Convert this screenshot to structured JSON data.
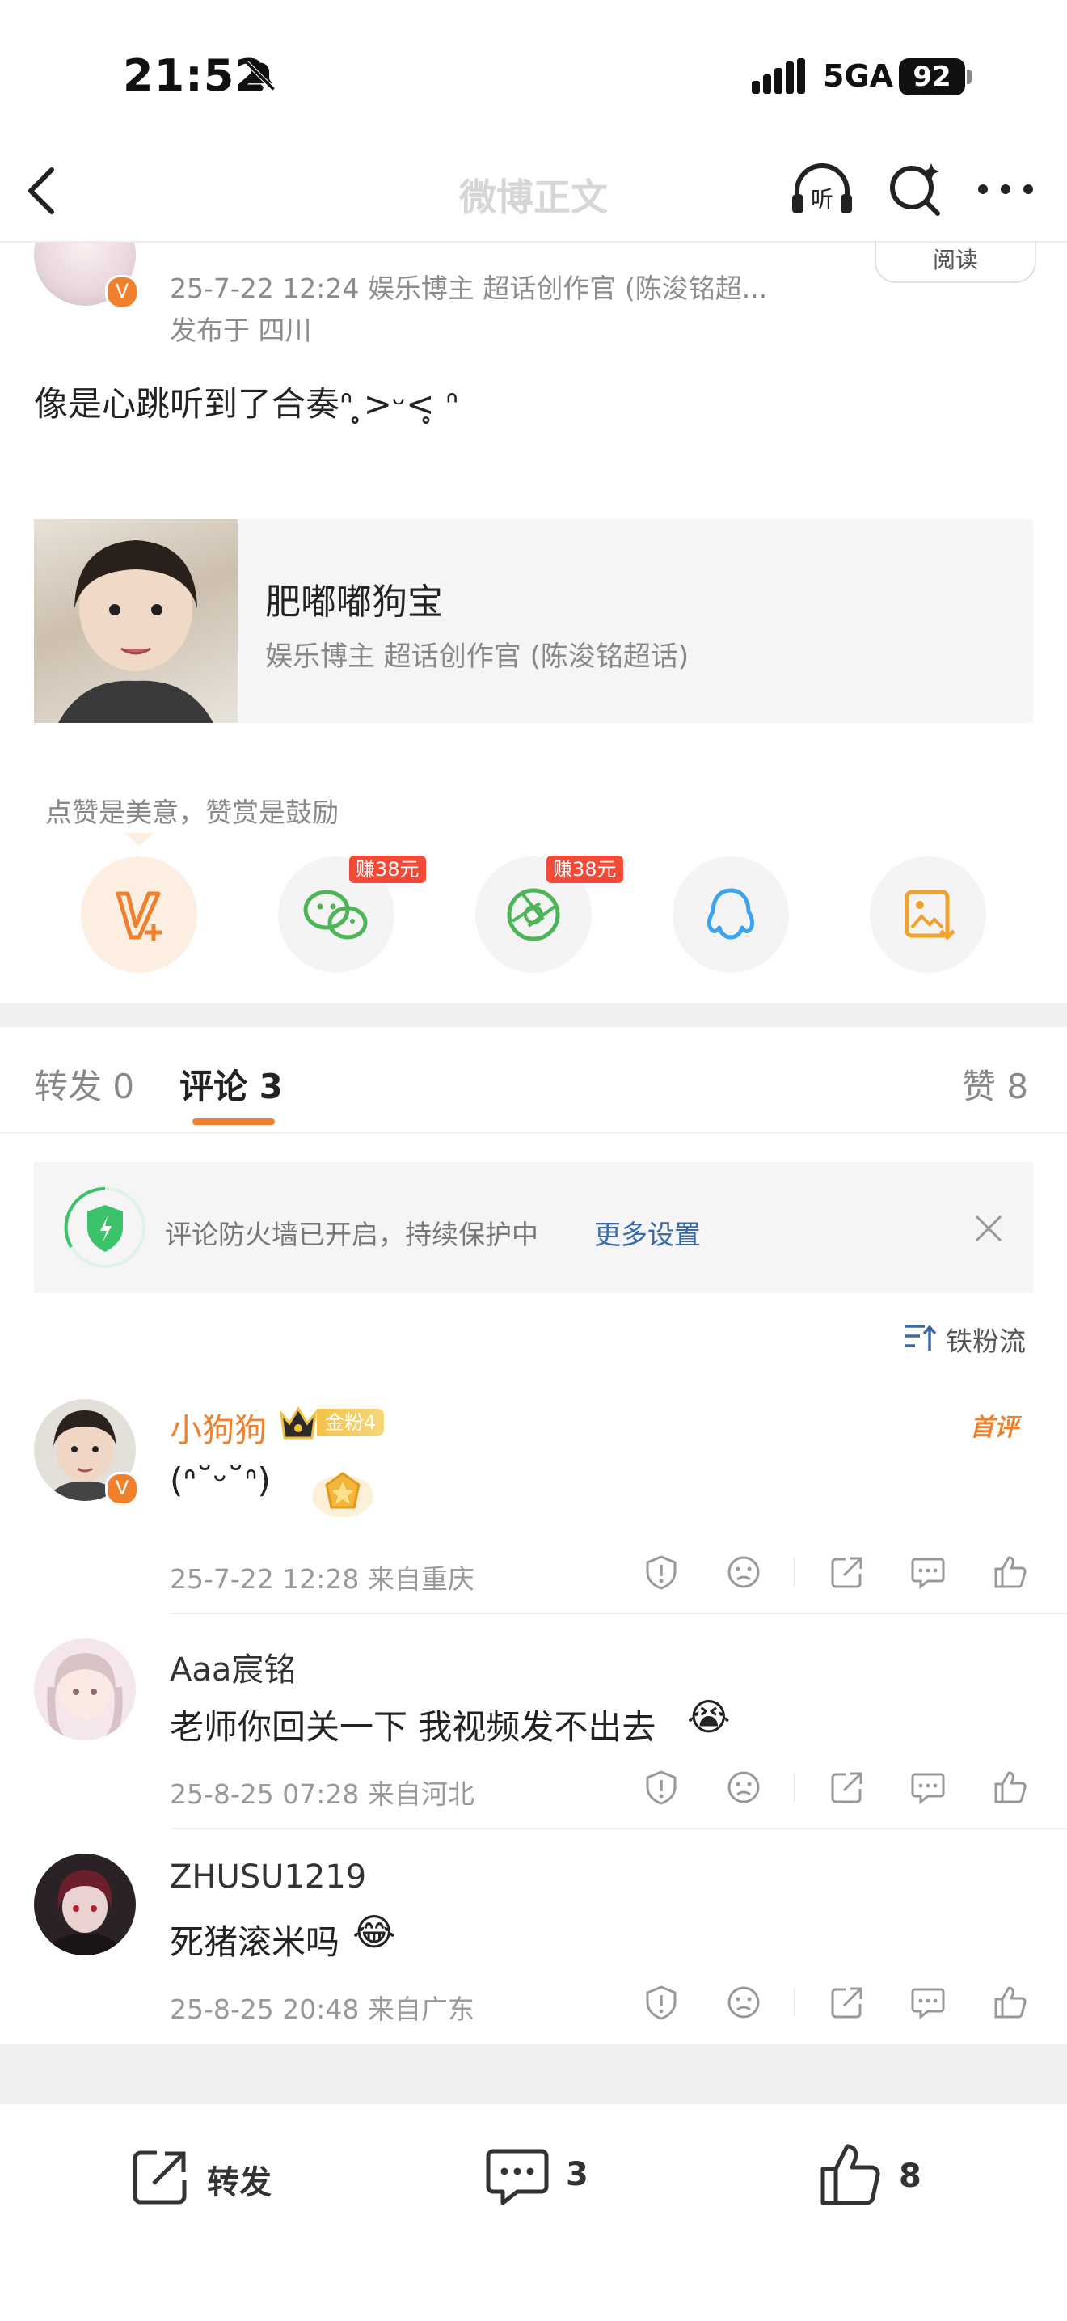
{
  "status_bar": {
    "time": "21:52",
    "network": "5GA",
    "battery": "92"
  },
  "nav": {
    "title": "微博正文"
  },
  "post": {
    "meta_line": "25-7-22 12:24  娱乐博主 超话创作官 (陈浚铭超...",
    "location": "发布于 四川",
    "read_label": "阅读",
    "text": "像是心跳听到了合奏ᐢ ̥>ᵕ<̥ ᐢ"
  },
  "card": {
    "title": "肥嘟嘟狗宝",
    "subtitle": "娱乐博主 超话创作官 (陈浚铭超话)"
  },
  "reward_tip": "点赞是美意，赞赏是鼓励",
  "share": {
    "earn_badge": "赚38元"
  },
  "tabs": {
    "repost": "转发 0",
    "comments": "评论 3",
    "likes": "赞 8"
  },
  "firewall": {
    "text": "评论防火墙已开启，持续保护中",
    "link": "更多设置"
  },
  "sort_label": "铁粉流",
  "comments": [
    {
      "name": "小狗狗",
      "badge": "金粉4",
      "tag": "首评",
      "text": "(ᐢ˘ᵕ˘ᐢ)",
      "meta": "25-7-22 12:28  来自重庆"
    },
    {
      "name": "Aaa宸铭",
      "text": "老师你回关一下 我视频发不出去",
      "emoji": "😭",
      "meta": "25-8-25 07:28  来自河北"
    },
    {
      "name": "ZHUSU1219",
      "text": "死猪滚米吗",
      "emoji": "😂",
      "meta": "25-8-25 20:48  来自广东"
    }
  ],
  "bottom_bar": {
    "repost_label": "转发",
    "comment_count": "3",
    "like_count": "8"
  },
  "colors": {
    "accent_orange": "#f0802c",
    "link_blue": "#3a6aa8",
    "earn_red": "#f24a36"
  }
}
